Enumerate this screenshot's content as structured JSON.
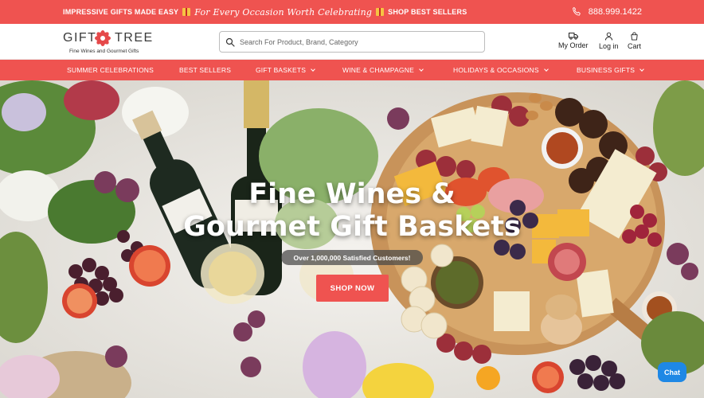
{
  "promo": {
    "left_text": "IMPRESSIVE GIFTS MADE EASY",
    "script_text": "For Every Occasion Worth Celebrating",
    "right_text": "SHOP BEST SELLERS",
    "phone": "888.999.1422",
    "gift_icon": "gift-icon",
    "phone_icon": "phone-icon"
  },
  "header": {
    "logo_left": "GIFT",
    "logo_right": "TREE",
    "logo_tagline": "Fine Wines and Gourmet Gifts",
    "search_placeholder": "Search For Product, Brand, Category",
    "my_order": "My Order",
    "login": "Log in",
    "cart": "Cart"
  },
  "nav": {
    "items": [
      {
        "label": "SUMMER CELEBRATIONS",
        "has_dropdown": false
      },
      {
        "label": "BEST SELLERS",
        "has_dropdown": false
      },
      {
        "label": "GIFT BASKETS",
        "has_dropdown": true
      },
      {
        "label": "WINE & CHAMPAGNE",
        "has_dropdown": true
      },
      {
        "label": "HOLIDAYS & OCCASIONS",
        "has_dropdown": true
      },
      {
        "label": "BUSINESS GIFTS",
        "has_dropdown": true
      }
    ]
  },
  "hero": {
    "title_line1": "Fine Wines &",
    "title_line2": "Gourmet Gift Baskets",
    "badge": "Over 1,000,000 Satisfied Customers!",
    "cta": "SHOP NOW"
  },
  "chat": {
    "label": "Chat"
  },
  "colors": {
    "brand_red": "#ef5350",
    "chat_blue": "#1e88e5"
  }
}
